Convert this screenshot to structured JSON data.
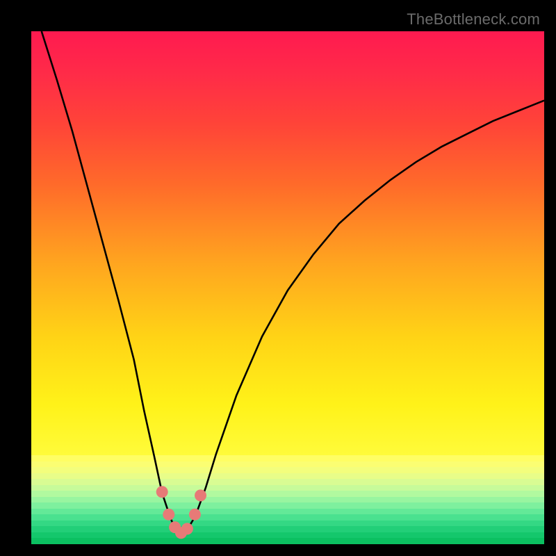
{
  "watermark": "TheBottleneck.com",
  "colors": {
    "frame": "#000000",
    "marker": "#e77a77",
    "curve": "#000000"
  },
  "chart_data": {
    "type": "line",
    "title": "",
    "xlabel": "",
    "ylabel": "",
    "xlim": [
      0,
      100
    ],
    "ylim": [
      0,
      100
    ],
    "grid": false,
    "legend": {
      "visible": false
    },
    "series": [
      {
        "name": "bottleneck-curve",
        "x": [
          2,
          5,
          8,
          11,
          14,
          17,
          20,
          22,
          24,
          25.5,
          27,
          28,
          29,
          30.5,
          32,
          34,
          36,
          40,
          45,
          50,
          55,
          60,
          65,
          70,
          75,
          80,
          85,
          90,
          95,
          100
        ],
        "values": [
          100,
          90.5,
          80.5,
          69.5,
          58.5,
          47.5,
          36,
          26,
          17,
          10,
          5.5,
          3,
          2,
          3,
          5.5,
          11,
          17.5,
          29,
          40.5,
          49.5,
          56.5,
          62.5,
          67,
          71,
          74.5,
          77.5,
          80,
          82.5,
          84.5,
          86.5
        ]
      }
    ],
    "markers": [
      {
        "x": 25.5,
        "y": 10.2
      },
      {
        "x": 26.8,
        "y": 5.8
      },
      {
        "x": 28.0,
        "y": 3.3
      },
      {
        "x": 29.2,
        "y": 2.2
      },
      {
        "x": 30.4,
        "y": 3.0
      },
      {
        "x": 31.9,
        "y": 5.8
      },
      {
        "x": 33.0,
        "y": 9.5
      }
    ],
    "color_bands": [
      {
        "start_pct": 0,
        "end_pct": 82.7,
        "gradient": "red-to-yellow"
      },
      {
        "start_pct": 82.7,
        "end_pct": 83.7,
        "color": "#fffe64"
      },
      {
        "start_pct": 83.7,
        "end_pct": 84.8,
        "color": "#fbfe72"
      },
      {
        "start_pct": 84.8,
        "end_pct": 86.0,
        "color": "#f3fe7d"
      },
      {
        "start_pct": 86.0,
        "end_pct": 87.2,
        "color": "#e8fd89"
      },
      {
        "start_pct": 87.2,
        "end_pct": 88.4,
        "color": "#d9fc93"
      },
      {
        "start_pct": 88.4,
        "end_pct": 89.6,
        "color": "#c7fb9a"
      },
      {
        "start_pct": 89.6,
        "end_pct": 90.8,
        "color": "#b1f99f"
      },
      {
        "start_pct": 90.8,
        "end_pct": 92.0,
        "color": "#98f5a0"
      },
      {
        "start_pct": 92.0,
        "end_pct": 93.2,
        "color": "#7ef09e"
      },
      {
        "start_pct": 93.2,
        "end_pct": 94.4,
        "color": "#63e998"
      },
      {
        "start_pct": 94.4,
        "end_pct": 95.6,
        "color": "#4ae18f"
      },
      {
        "start_pct": 95.6,
        "end_pct": 96.8,
        "color": "#34d884"
      },
      {
        "start_pct": 96.8,
        "end_pct": 98.0,
        "color": "#22cf78"
      },
      {
        "start_pct": 98.0,
        "end_pct": 99.0,
        "color": "#14c76c"
      },
      {
        "start_pct": 99.0,
        "end_pct": 100,
        "color": "#0bc061"
      }
    ]
  }
}
